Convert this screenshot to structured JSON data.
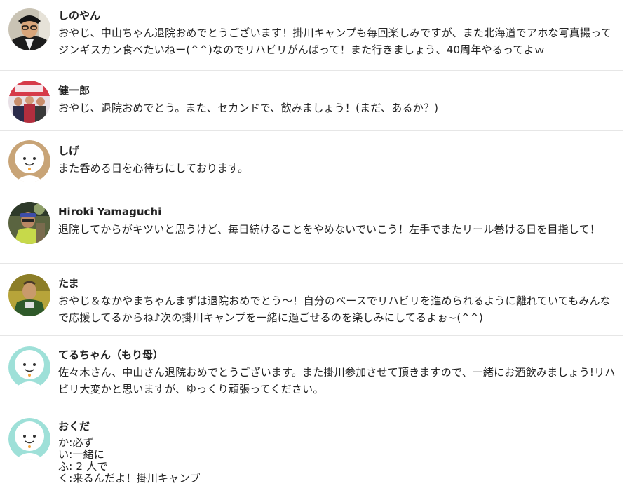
{
  "comments": [
    {
      "name": "しのやん",
      "text": "おやじ、中山ちゃん退院おめでとうございます！掛川キャンプも毎回楽しみですが、また北海道でアホな写真撮ってジンギスカン食べたいねー(^^)なのでリハビリがんばって！また行きましょう、40周年やるってよｗ",
      "avatar": "photo-man-glasses-icon"
    },
    {
      "name": "健一郎",
      "text": "おやじ、退院おめでとう。また、セカンドで、飲みましょう！(まだ、あるか？)",
      "avatar": "photo-group-icon"
    },
    {
      "name": "しげ",
      "text": "また呑める日を心待ちにしております。",
      "avatar": "default-face-tan-icon",
      "avatar_color": "#c8a477"
    },
    {
      "name": "Hiroki Yamaguchi",
      "text": "退院してからがキツいと思うけど、毎日続けることをやめないでいこう！左手でまたリール巻ける日を目指して！",
      "avatar": "photo-outdoor-icon"
    },
    {
      "name": "たま",
      "text": "おやじ＆なかやまちゃんまずは退院おめでとう～！自分のペースでリハビリを進められるように離れていてもみんなで応援してるからね♪次の掛川キャンプを一緒に過ごせるのを楽しみにしてるよぉ~(^^)",
      "avatar": "photo-man-green-icon"
    },
    {
      "name": "てるちゃん（もり母）",
      "text": "佐々木さん、中山さん退院おめでとうございます。また掛川参加させて頂きますので、一緒にお酒飲みましょう!リハビリ大変かと思いますが、ゆっくり頑張ってください。",
      "avatar": "default-face-mint-icon",
      "avatar_color": "#9ee0d8"
    },
    {
      "name": "おくだ",
      "text": "か:必ず\nい:一緒に\nふ: 2 人で\nく:来るんだよ！掛川キャンプ",
      "avatar": "default-face-mint-icon",
      "avatar_color": "#9ee0d8"
    }
  ]
}
